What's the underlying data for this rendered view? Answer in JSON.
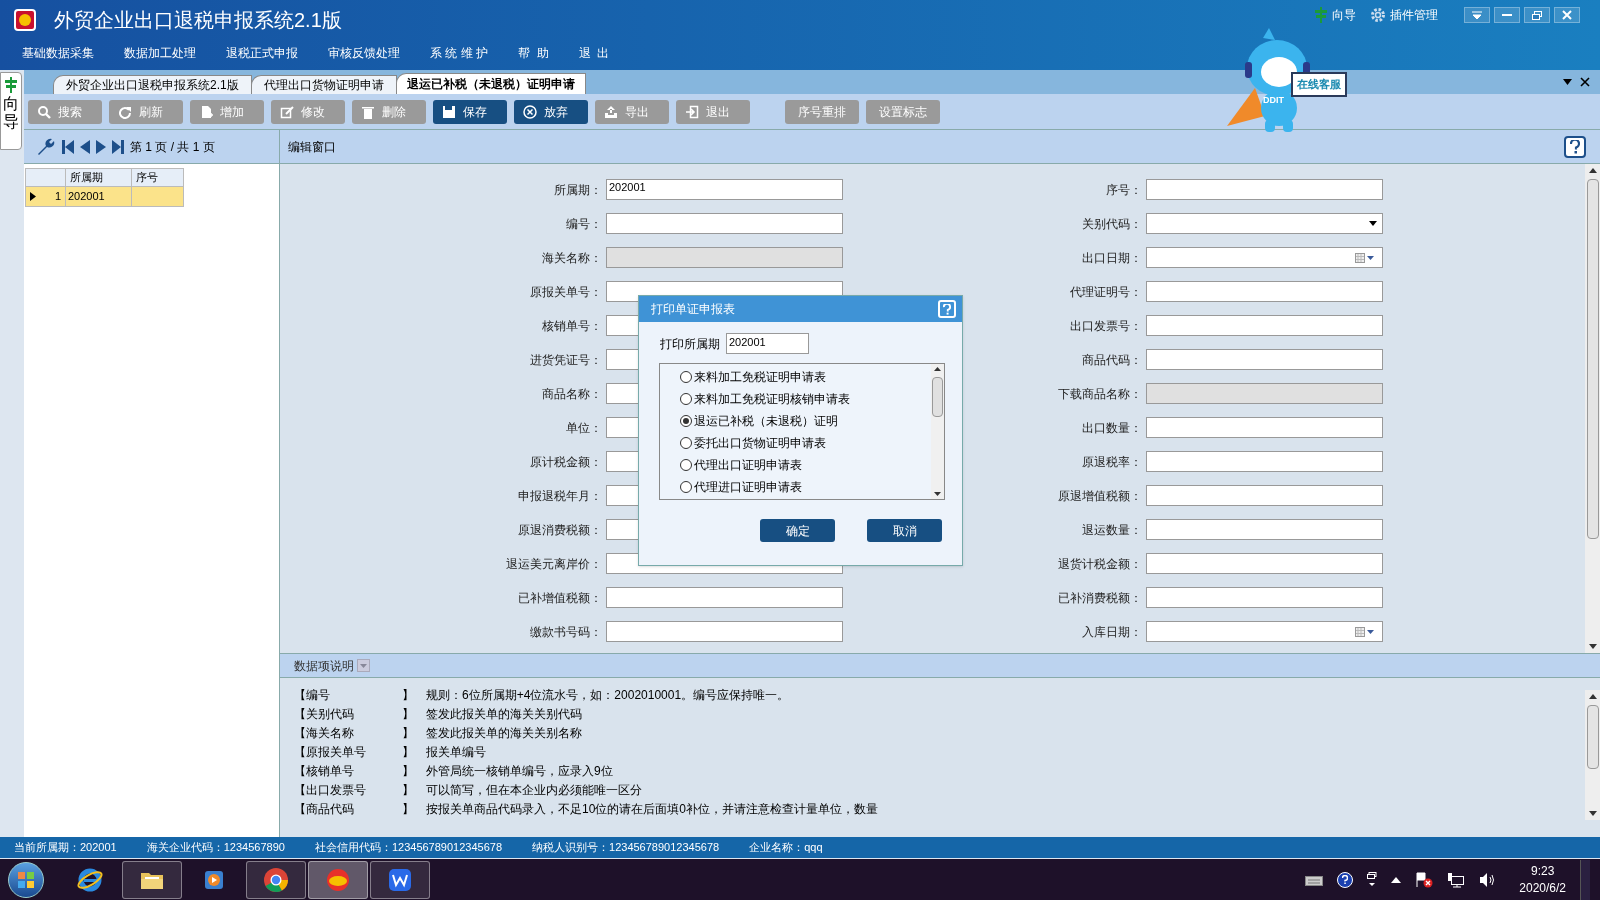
{
  "window": {
    "title": "外贸企业出口退税申报系统2.1版",
    "controls": [
      {
        "kind": "guide",
        "label": "向导"
      },
      {
        "kind": "plugins",
        "label": "插件管理"
      }
    ]
  },
  "menu": [
    "基础数据采集",
    "数据加工处理",
    "退税正式申报",
    "审核反馈处理",
    "系 统 维 护",
    "帮  助",
    "退  出"
  ],
  "side_tab": {
    "label": "向导"
  },
  "mascot": {
    "sign": "在线客服",
    "badge": "DDIT"
  },
  "tabs": [
    {
      "label": "外贸企业出口退税申报系统2.1版",
      "selected": false
    },
    {
      "label": "代理出口货物证明申请",
      "selected": false
    },
    {
      "label": "退运已补税（未退税）证明申请",
      "selected": true
    }
  ],
  "toolbar": [
    {
      "label": "搜索",
      "kind": "search",
      "disabled": true
    },
    {
      "label": "刷新",
      "kind": "refresh",
      "disabled": true
    },
    {
      "label": "增加",
      "kind": "add",
      "disabled": true
    },
    {
      "label": "修改",
      "kind": "edit",
      "disabled": true
    },
    {
      "label": "删除",
      "kind": "delete",
      "disabled": true
    },
    {
      "label": "保存",
      "kind": "save",
      "disabled": false
    },
    {
      "label": "放弃",
      "kind": "cancel",
      "disabled": false
    },
    {
      "label": "导出",
      "kind": "export",
      "disabled": true
    },
    {
      "label": "退出",
      "kind": "exit",
      "disabled": true
    },
    {
      "label": "序号重排",
      "kind": "plain",
      "disabled": true
    },
    {
      "label": "设置标志",
      "kind": "plain",
      "disabled": true
    }
  ],
  "pager": {
    "text": "第 1 页 / 共 1 页"
  },
  "grid": {
    "columns": [
      "所属期",
      "序号"
    ],
    "rows": [
      {
        "index": "1",
        "period": "202001",
        "selected": true
      }
    ]
  },
  "editor": {
    "title": "编辑窗口",
    "left_fields": [
      {
        "label": "所属期：",
        "kind": "text",
        "value": "202001"
      },
      {
        "label": "编号：",
        "kind": "text"
      },
      {
        "label": "海关名称：",
        "kind": "readonly"
      },
      {
        "label": "原报关单号：",
        "kind": "text"
      },
      {
        "label": "核销单号：",
        "kind": "text"
      },
      {
        "label": "进货凭证号：",
        "kind": "text"
      },
      {
        "label": "商品名称：",
        "kind": "text"
      },
      {
        "label": "单位：",
        "kind": "text"
      },
      {
        "label": "原计税金额：",
        "kind": "text"
      },
      {
        "label": "申报退税年月：",
        "kind": "text"
      },
      {
        "label": "原退消费税额：",
        "kind": "text"
      },
      {
        "label": "退运美元离岸价：",
        "kind": "text"
      },
      {
        "label": "已补增值税额：",
        "kind": "text"
      },
      {
        "label": "缴款书号码：",
        "kind": "text"
      }
    ],
    "right_fields": [
      {
        "label": "序号：",
        "kind": "text"
      },
      {
        "label": "关别代码：",
        "kind": "select"
      },
      {
        "label": "出口日期：",
        "kind": "date"
      },
      {
        "label": "代理证明号：",
        "kind": "text"
      },
      {
        "label": "出口发票号：",
        "kind": "text"
      },
      {
        "label": "商品代码：",
        "kind": "text"
      },
      {
        "label": "下载商品名称：",
        "kind": "readonly"
      },
      {
        "label": "出口数量：",
        "kind": "text"
      },
      {
        "label": "原退税率：",
        "kind": "text"
      },
      {
        "label": "原退增值税额：",
        "kind": "text"
      },
      {
        "label": "退运数量：",
        "kind": "text"
      },
      {
        "label": "退货计税金额：",
        "kind": "text"
      },
      {
        "label": "已补消费税额：",
        "kind": "text"
      },
      {
        "label": "入库日期：",
        "kind": "date"
      }
    ]
  },
  "description": {
    "title": "数据项说明",
    "rows": [
      {
        "key": "【编号",
        "close": "】",
        "text": "规则：6位所属期+4位流水号，如：2002010001。编号应保持唯一。"
      },
      {
        "key": "【关别代码",
        "close": "】",
        "text": "签发此报关单的海关关别代码"
      },
      {
        "key": "【海关名称",
        "close": "】",
        "text": "签发此报关单的海关关别名称"
      },
      {
        "key": "【原报关单号",
        "close": "】",
        "text": "报关单编号"
      },
      {
        "key": "【核销单号",
        "close": "】",
        "text": "外管局统一核销单编号，应录入9位"
      },
      {
        "key": "【出口发票号",
        "close": "】",
        "text": "可以简写，但在本企业内必须能唯一区分"
      },
      {
        "key": "【商品代码",
        "close": "】",
        "text": "按报关单商品代码录入，不足10位的请在后面填0补位，并请注意检查计量单位，数量"
      }
    ]
  },
  "dialog": {
    "title": "打印单证申报表",
    "period_label": "打印所属期",
    "period_value": "202001",
    "options": [
      {
        "label": "来料加工免税证明申请表",
        "selected": false
      },
      {
        "label": "来料加工免税证明核销申请表",
        "selected": false
      },
      {
        "label": "退运已补税（未退税）证明",
        "selected": true
      },
      {
        "label": "委托出口货物证明申请表",
        "selected": false
      },
      {
        "label": "代理出口证明申请表",
        "selected": false
      },
      {
        "label": "代理进口证明申请表",
        "selected": false
      }
    ],
    "buttons": [
      "确定",
      "取消"
    ]
  },
  "status_bar": [
    "当前所属期：202001",
    "海关企业代码：1234567890",
    "社会信用代码：123456789012345678",
    "纳税人识别号：123456789012345678",
    "企业名称：qqq"
  ],
  "taskbar": {
    "apps": [
      {
        "kind": "ie",
        "running": false,
        "selected": false
      },
      {
        "kind": "folder",
        "running": true,
        "selected": false
      },
      {
        "kind": "media",
        "running": false,
        "selected": false
      },
      {
        "kind": "chrome",
        "running": true,
        "selected": false
      },
      {
        "kind": "tax",
        "running": true,
        "selected": true
      },
      {
        "kind": "wps",
        "running": true,
        "selected": false
      }
    ],
    "time": "9:23",
    "date": "2020/6/2"
  }
}
